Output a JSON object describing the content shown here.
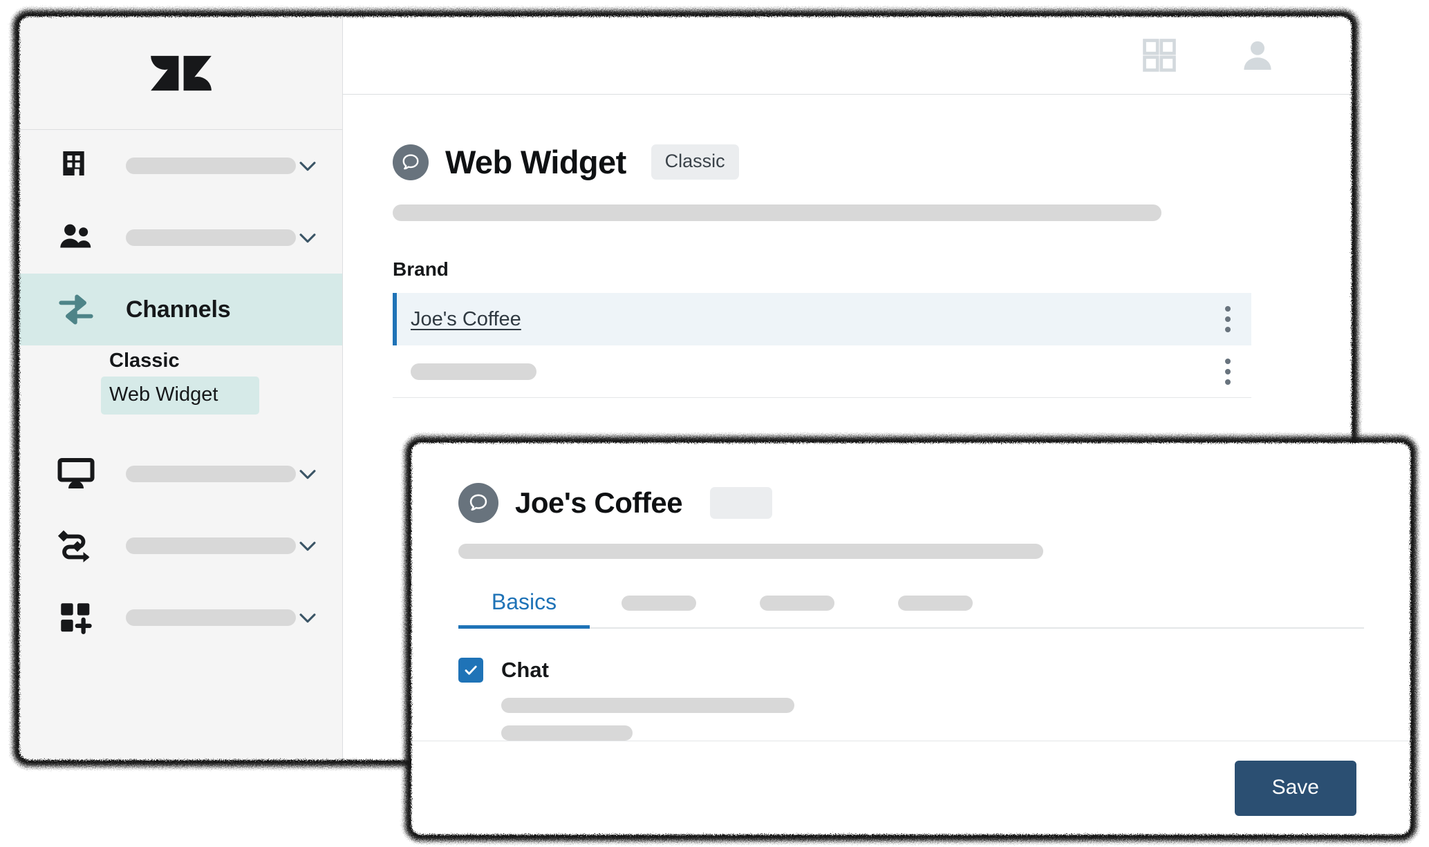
{
  "app": {
    "logo_name": "zendesk-logo"
  },
  "topbar": {
    "apps_icon": "grid-apps-icon",
    "avatar_icon": "user-avatar-icon"
  },
  "sidebar": {
    "items": [
      {
        "id": "organizations",
        "icon": "building-icon",
        "label": "",
        "placeholder_bar": true,
        "has_chevron": true,
        "active": false
      },
      {
        "id": "people",
        "icon": "people-icon",
        "label": "",
        "placeholder_bar": true,
        "has_chevron": true,
        "active": false
      },
      {
        "id": "channels",
        "icon": "channels-arrows-icon",
        "label": "Channels",
        "placeholder_bar": false,
        "has_chevron": false,
        "active": true
      },
      {
        "id": "workspaces",
        "icon": "monitor-icon",
        "label": "",
        "placeholder_bar": true,
        "has_chevron": true,
        "active": false
      },
      {
        "id": "objects-rules",
        "icon": "workflow-icon",
        "label": "",
        "placeholder_bar": true,
        "has_chevron": true,
        "active": false
      },
      {
        "id": "apps-integrations",
        "icon": "apps-add-icon",
        "label": "",
        "placeholder_bar": true,
        "has_chevron": true,
        "active": false
      }
    ],
    "subnav": {
      "group_label": "Classic",
      "selected_item": "Web Widget"
    }
  },
  "main": {
    "page_title": "Web Widget",
    "page_badge": "Classic",
    "title_icon": "chat-bubble-icon",
    "brand_section_label": "Brand",
    "brand_rows": [
      {
        "name": "Joe's Coffee",
        "selected": true,
        "menu_icon": "kebab-menu-icon"
      },
      {
        "name": "",
        "selected": false,
        "menu_icon": "kebab-menu-icon"
      }
    ]
  },
  "modal": {
    "title": "Joe's Coffee",
    "title_icon": "chat-bubble-icon",
    "tabs": [
      {
        "label": "Basics",
        "active": true
      },
      {
        "label": "",
        "active": false
      },
      {
        "label": "",
        "active": false
      },
      {
        "label": "",
        "active": false
      }
    ],
    "chat_setting": {
      "label": "Chat",
      "checked": true,
      "check_icon": "checkmark-icon"
    },
    "footer": {
      "save_label": "Save"
    }
  },
  "colors": {
    "accent_blue": "#1f73b7",
    "save_button": "#2b4f72",
    "active_nav": "#d6eae8",
    "selected_row": "#eef4f8",
    "placeholder_gray": "#d8d8d8",
    "icon_gray": "#68737d"
  }
}
